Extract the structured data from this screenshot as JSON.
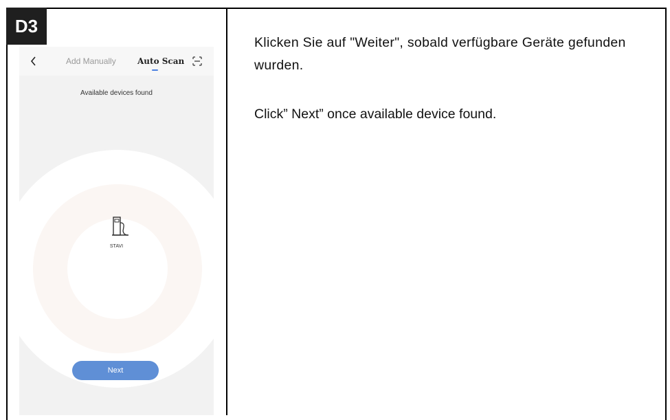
{
  "step": {
    "badge": "D3"
  },
  "phone": {
    "tabs": {
      "manual": "Add Manually",
      "auto": "Auto Scan"
    },
    "icons": {
      "back": "back-chevron-icon",
      "scan": "scan-frame-icon",
      "device": "charger-station-icon"
    },
    "status": "Available devices found",
    "device_name": "STAVI",
    "next_label": "Next",
    "colors": {
      "accent": "#5f8fd6",
      "tab_indicator": "#4a7fe0"
    }
  },
  "instructions": {
    "german": "Klicken Sie auf \"Weiter\", sobald verfügbare Geräte gefunden wurden.",
    "english": "Click” Next” once available device found."
  }
}
